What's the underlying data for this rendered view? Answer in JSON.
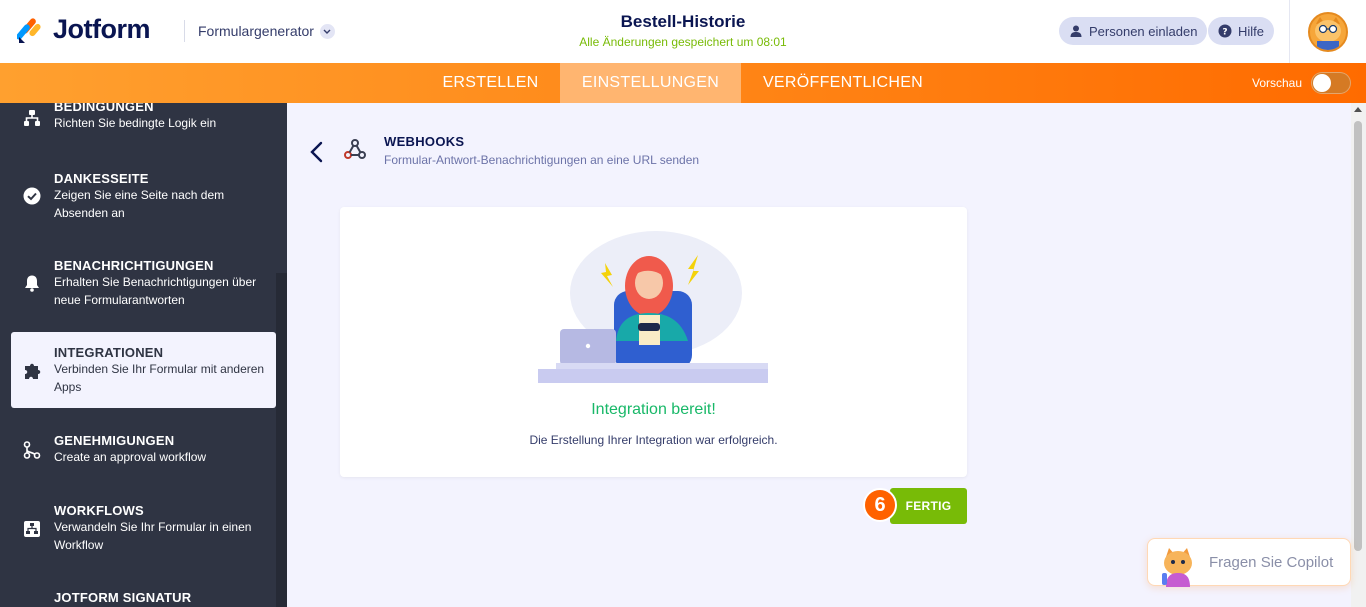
{
  "header": {
    "logo_text": "Jotform",
    "form_generator": "Formulargenerator",
    "form_title": "Bestell-Historie",
    "save_status": "Alle Änderungen gespeichert um 08:01",
    "invite_label": "Personen einladen",
    "help_label": "Hilfe"
  },
  "nav": {
    "tabs": [
      {
        "label": "ERSTELLEN"
      },
      {
        "label": "EINSTELLUNGEN"
      },
      {
        "label": "VERÖFFENTLICHEN"
      }
    ],
    "active_tab": "EINSTELLUNGEN",
    "preview_label": "Vorschau",
    "preview_on": false
  },
  "sidebar": {
    "items": [
      {
        "title": "BEDINGUNGEN",
        "desc": "Richten Sie bedingte Logik ein",
        "icon": "conditions-icon"
      },
      {
        "title": "DANKESSEITE",
        "desc": "Zeigen Sie eine Seite nach dem Absenden an",
        "icon": "check-circle-icon"
      },
      {
        "title": "BENACHRICHTIGUNGEN",
        "desc": "Erhalten Sie Benachrichtigungen über neue Formularantworten",
        "icon": "bell-icon"
      },
      {
        "title": "INTEGRATIONEN",
        "desc": "Verbinden Sie Ihr Formular mit anderen Apps",
        "icon": "puzzle-icon",
        "active": true
      },
      {
        "title": "GENEHMIGUNGEN",
        "desc": "Create an approval workflow",
        "icon": "approval-icon"
      },
      {
        "title": "WORKFLOWS",
        "desc": "Verwandeln Sie Ihr Formular in einen Workflow",
        "icon": "workflow-icon"
      },
      {
        "title": "JOTFORM SIGNATUR",
        "desc": "",
        "icon": ""
      }
    ]
  },
  "webhooks": {
    "title": "WEBHOOKS",
    "subtitle": "Formular-Antwort-Benachrichtigungen an eine URL senden"
  },
  "card": {
    "ready_title": "Integration bereit!",
    "success_message": "Die Erstellung Ihrer Integration war erfolgreich."
  },
  "done_button": "FERTIG",
  "step_badge": "6",
  "copilot_label": "Fragen Sie Copilot",
  "colors": {
    "brand_navy": "#0a1551",
    "orange": "#ff6100",
    "green": "#78bb07",
    "success_text": "#18b868",
    "sidebar_bg": "#2f3443"
  }
}
